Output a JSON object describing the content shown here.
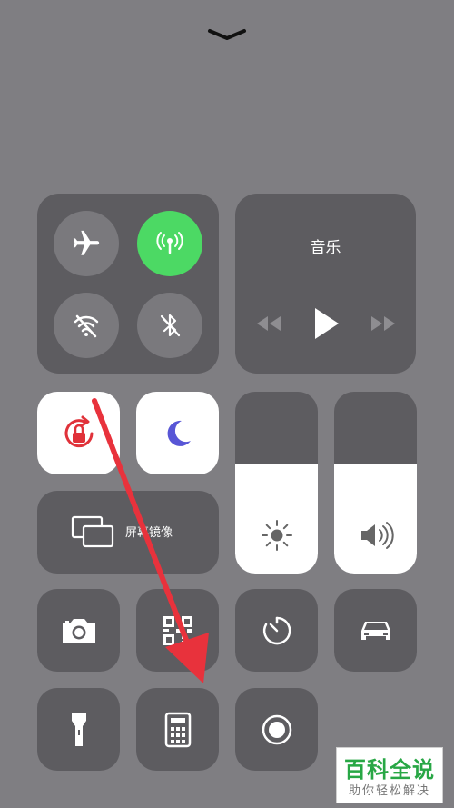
{
  "music": {
    "title": "音乐"
  },
  "screen_mirroring": {
    "label": "屏幕镜像"
  },
  "sliders": {
    "brightness_level": 0.6,
    "volume_level": 0.6
  },
  "watermark": {
    "line1": "百科全说",
    "line2": "助你轻松解决"
  },
  "colors": {
    "background": "#7f7e82",
    "tile": "#5d5c60",
    "green": "#4cd964",
    "arrow": "#e8323c",
    "moon": "#5856d6",
    "lock_red": "#e0323a"
  }
}
